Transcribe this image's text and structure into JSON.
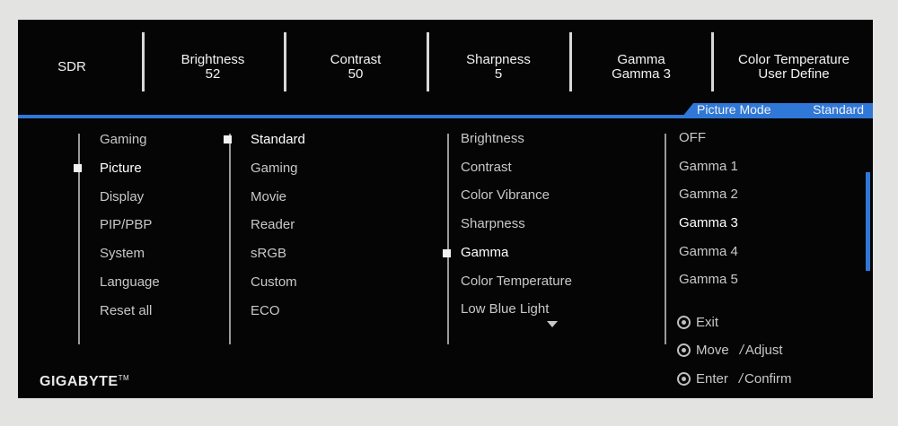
{
  "status": [
    {
      "label": "SDR",
      "value": ""
    },
    {
      "label": "Brightness",
      "value": "52"
    },
    {
      "label": "Contrast",
      "value": "50"
    },
    {
      "label": "Sharpness",
      "value": "5"
    },
    {
      "label": "Gamma",
      "value": "Gamma 3"
    },
    {
      "label": "Color Temperature",
      "value": "User Define"
    }
  ],
  "mode_tab": {
    "label": "Picture Mode",
    "value": "Standard"
  },
  "main_menu": [
    "Gaming",
    "Picture",
    "Display",
    "PIP/PBP",
    "System",
    "Language",
    "Reset all"
  ],
  "picture_modes": [
    "Standard",
    "Gaming",
    "Movie",
    "Reader",
    "sRGB",
    "Custom",
    "ECO"
  ],
  "picture_settings": [
    "Brightness",
    "Contrast",
    "Color Vibrance",
    "Sharpness",
    "Gamma",
    "Color Temperature",
    "Low Blue Light"
  ],
  "gamma_options": [
    "OFF",
    "Gamma 1",
    "Gamma 2",
    "Gamma 3",
    "Gamma 4",
    "Gamma 5"
  ],
  "guide": {
    "exit": "Exit",
    "move": "Move",
    "adjust": "Adjust",
    "enter": "Enter",
    "confirm": "Confirm",
    "slash": "/"
  },
  "brand": {
    "name": "GIGABYTE",
    "tm": "TM"
  },
  "colors": {
    "accent": "#2f78d8",
    "background": "#050505",
    "text": "#c8c8c8"
  }
}
